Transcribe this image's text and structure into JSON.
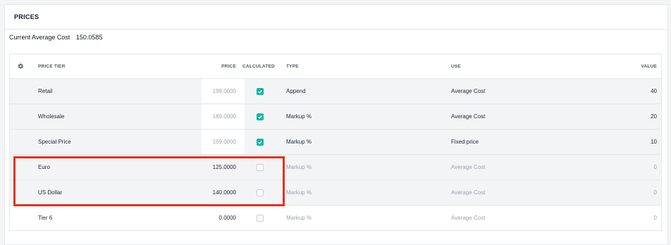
{
  "section_title": "PRICES",
  "avg_cost": {
    "label": "Current Average Cost",
    "value": "150.0585"
  },
  "table": {
    "headers": {
      "settings_icon": "gear-icon",
      "tier": "PRICE TIER",
      "price": "PRICE",
      "calculated": "CALCULATED",
      "type": "TYPE",
      "use": "USE",
      "value": "VALUE"
    },
    "rows": [
      {
        "tier": "Retail",
        "price": "199.0000",
        "calculated": true,
        "type": "Append",
        "use": "Average Cost",
        "value": "40"
      },
      {
        "tier": "Wholesale",
        "price": "189.0000",
        "calculated": true,
        "type": "Markup %",
        "use": "Average Cost",
        "value": "20"
      },
      {
        "tier": "Special Price",
        "price": "169.0000",
        "calculated": true,
        "type": "Markup %",
        "use": "Fixed price",
        "value": "10"
      },
      {
        "tier": "Euro",
        "price": "125.0000",
        "calculated": false,
        "type": "Markup %",
        "use": "Average Cost",
        "value": "0"
      },
      {
        "tier": "US Dollar",
        "price": "140.0000",
        "calculated": false,
        "type": "Markup %",
        "use": "Average Cost",
        "value": "0"
      },
      {
        "tier": "Tier 6",
        "price": "0.0000",
        "calculated": false,
        "type": "Markup %",
        "use": "Average Cost",
        "value": "0"
      }
    ]
  },
  "colors": {
    "checkbox_checked": "#14b8a6",
    "highlight_border": "#e5321d"
  }
}
